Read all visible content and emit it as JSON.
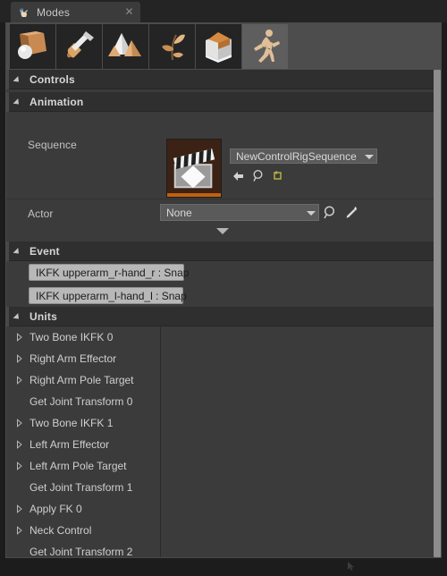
{
  "window": {
    "tab_title": "Modes",
    "tab_icon": "modes-hand-icon",
    "close_icon": "close-icon"
  },
  "mode_toolbar": {
    "modes": [
      {
        "name": "place-mode",
        "icon": "cube-sphere-icon",
        "selected": false
      },
      {
        "name": "paint-mode",
        "icon": "paintbrush-icon",
        "selected": false
      },
      {
        "name": "landscape-mode",
        "icon": "mountain-icon",
        "selected": false
      },
      {
        "name": "foliage-mode",
        "icon": "leaf-icon",
        "selected": false
      },
      {
        "name": "geometry-mode",
        "icon": "geometry-box-icon",
        "selected": false
      },
      {
        "name": "animation-mode",
        "icon": "running-man-icon",
        "selected": true
      }
    ]
  },
  "sections": {
    "controls": {
      "label": "Controls",
      "expanded": true
    },
    "animation": {
      "label": "Animation",
      "expanded": true
    },
    "event": {
      "label": "Event",
      "expanded": true
    },
    "units": {
      "label": "Units",
      "expanded": true
    }
  },
  "animation": {
    "sequence": {
      "label": "Sequence",
      "value": "NewControlRigSequence",
      "thumbnail_icon": "clapperboard-icon",
      "actions": [
        {
          "name": "browse-back-button",
          "icon": "arrow-left-icon"
        },
        {
          "name": "find-in-content-browser-button",
          "icon": "magnifier-icon"
        },
        {
          "name": "reset-to-default-button",
          "icon": "reset-arrow-icon"
        }
      ]
    },
    "actor": {
      "label": "Actor",
      "value": "None",
      "actions": [
        {
          "name": "browse-actor-button",
          "icon": "magnifier-icon"
        },
        {
          "name": "pick-actor-button",
          "icon": "eyedropper-icon"
        }
      ]
    },
    "expand_more_icon": "chevron-down-icon"
  },
  "event": {
    "buttons": [
      {
        "label": "IKFK upperarm_r-hand_r : Snap"
      },
      {
        "label": "IKFK upperarm_l-hand_l : Snap"
      }
    ]
  },
  "units": {
    "items": [
      {
        "label": "Two Bone IKFK 0",
        "expandable": true
      },
      {
        "label": "Right Arm Effector",
        "expandable": true
      },
      {
        "label": "Right Arm Pole Target",
        "expandable": true
      },
      {
        "label": "Get Joint Transform 0",
        "expandable": false
      },
      {
        "label": "Two Bone IKFK 1",
        "expandable": true
      },
      {
        "label": "Left Arm Effector",
        "expandable": true
      },
      {
        "label": "Left Arm Pole Target",
        "expandable": true
      },
      {
        "label": "Get Joint Transform 1",
        "expandable": false
      },
      {
        "label": "Apply FK 0",
        "expandable": true
      },
      {
        "label": "Neck Control",
        "expandable": true
      },
      {
        "label": "Get Joint Transform 2",
        "expandable": false
      }
    ]
  },
  "colors": {
    "panel_bg": "#3b3b3b",
    "section_bg": "#2f2f2f",
    "toolbar_bg": "#4d4d4d",
    "selected_mode_bg": "#5e5e5e",
    "combo_bg": "#5a5a5a",
    "event_button_bg": "#b8b8b8",
    "thumbnail_bg": "#3b2215",
    "thumbnail_accent": "#c2600e",
    "scrollbar_thumb": "#8d8d8d",
    "text_primary": "#cfcfcf"
  }
}
